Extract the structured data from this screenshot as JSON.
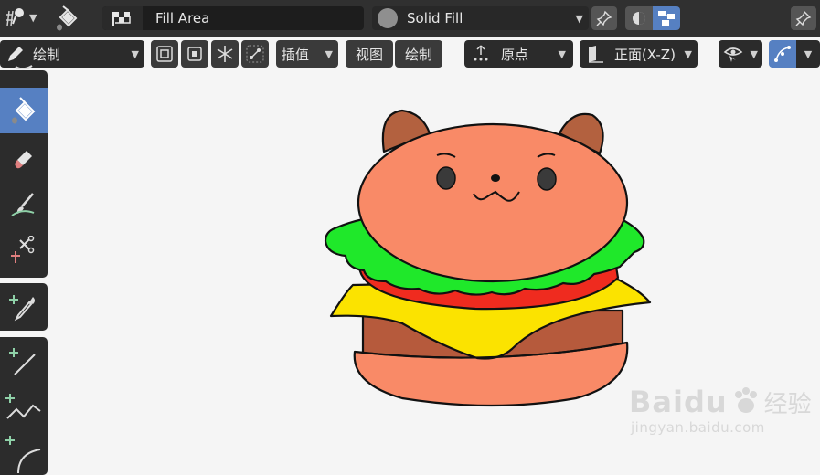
{
  "topbar": {
    "material_name": "Fill Area",
    "fill_mode": "Solid Fill"
  },
  "header2": {
    "mode_label": "绘制",
    "interpolate_label": "插值",
    "view_label": "视图",
    "draw_label": "绘制",
    "origin_label": "原点",
    "orientation_label": "正面(X-Z)"
  },
  "tools": [
    "pencil-tool",
    "fill-tool",
    "erase-tool",
    "tint-tool",
    "cutter-tool",
    "eyedropper-tool",
    "line-tool",
    "polyline-tool",
    "arc-tool"
  ],
  "watermark": {
    "brand": "Baidu",
    "brand_cn": "经验",
    "url": "jingyan.baidu.com"
  },
  "colors": {
    "accent": "#5680c2",
    "bun": "#f98a67",
    "ear": "#b3613f",
    "lettuce": "#1fe82a",
    "tomato": "#ef2b1f",
    "cheese": "#fbe300",
    "patty": "#b65a3c"
  }
}
